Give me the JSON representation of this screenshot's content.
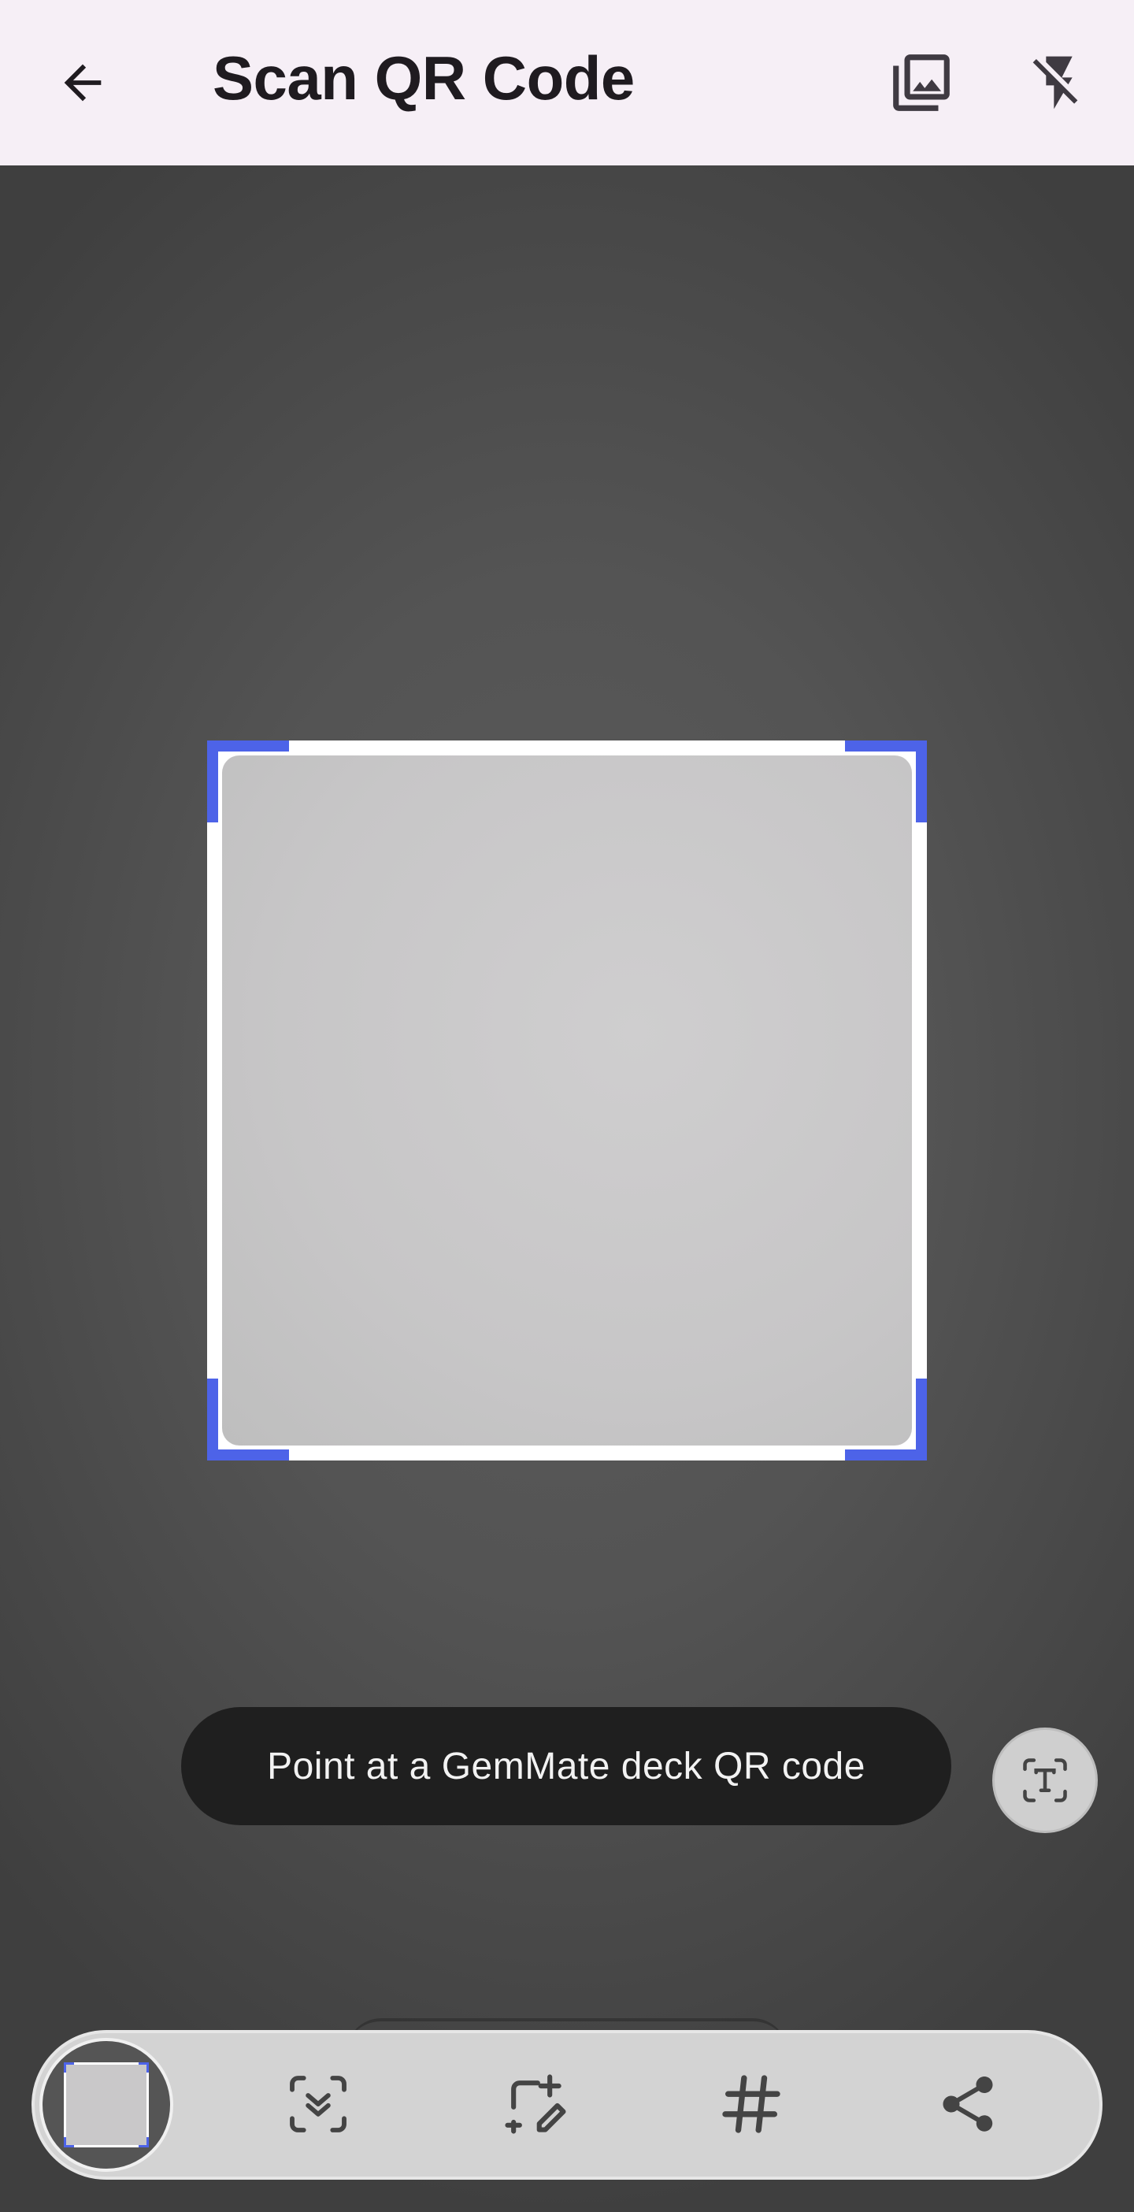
{
  "header": {
    "title": "Scan QR Code",
    "back_icon": "arrow-back-icon",
    "gallery_icon": "photo-library-icon",
    "flash_icon": "flash-off-icon",
    "background": "#f6eff6"
  },
  "scanner": {
    "corner_color": "#4d63e8",
    "hint": "Point at a GemMate deck QR code",
    "text_mode_icon": "text-scan-icon"
  },
  "toolbar": {
    "items": [
      {
        "name": "thumbnail",
        "icon": "captured-image-thumbnail"
      },
      {
        "name": "scan",
        "icon": "document-scan-icon"
      },
      {
        "name": "edit",
        "icon": "add-edit-icon"
      },
      {
        "name": "hashtag",
        "icon": "hashtag-icon"
      },
      {
        "name": "share",
        "icon": "share-icon"
      }
    ]
  }
}
